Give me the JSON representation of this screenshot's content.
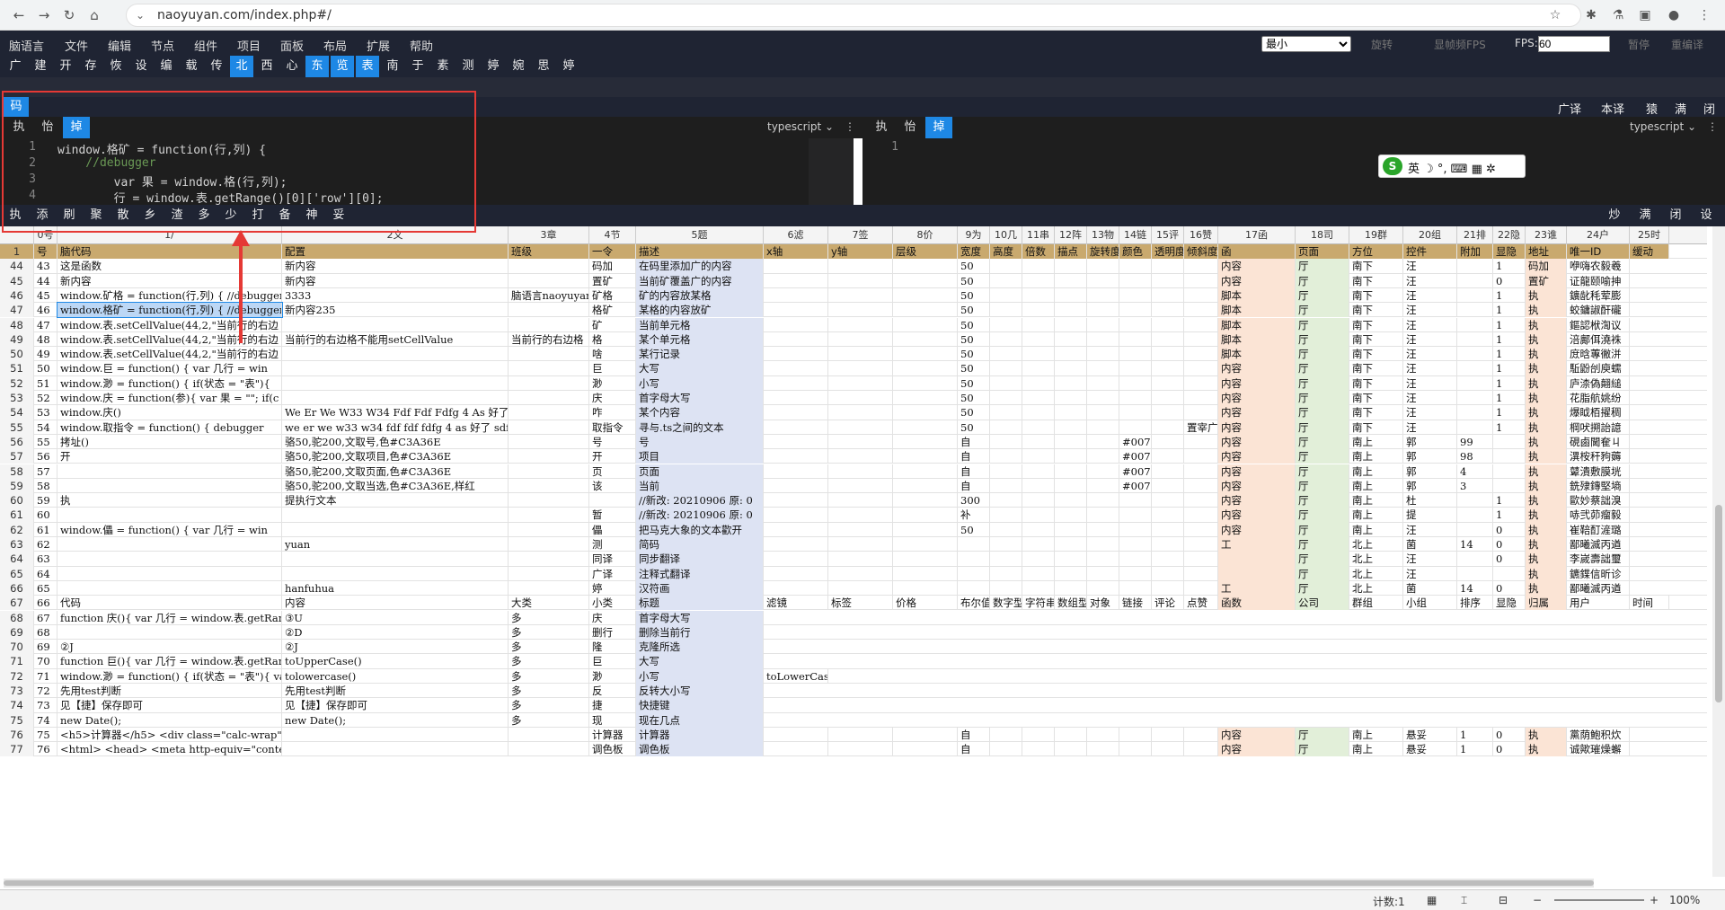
{
  "browser": {
    "url": "naoyuyan.com/index.php#/"
  },
  "menu": {
    "items": [
      "脑语言",
      "文件",
      "编辑",
      "节点",
      "组件",
      "项目",
      "面板",
      "布局",
      "扩展",
      "帮助"
    ],
    "select": "最小",
    "rotate": "旋转",
    "show_fps": "显帧频FPS",
    "fps_label": "FPS:",
    "fps_value": "60",
    "pause": "暂停",
    "recompile": "重编译"
  },
  "toolbar": {
    "items": [
      "广",
      "建",
      "开",
      "存",
      "恢",
      "设",
      "编",
      "载",
      "传",
      "北",
      "西",
      "心",
      "东",
      "览",
      "表",
      "南",
      "于",
      "素",
      "测",
      "婷",
      "婉",
      "思",
      "婷"
    ],
    "active": [
      9,
      12,
      13,
      14
    ]
  },
  "codepanel": {
    "tag": "码",
    "right": [
      "广译",
      "本译",
      "猿",
      "满",
      "闭"
    ]
  },
  "editor1": {
    "buttons": [
      "执",
      "怡",
      "掉"
    ],
    "lang": "typescript",
    "lines": [
      {
        "n": "1",
        "t": "window.格矿 = function(行,列) {"
      },
      {
        "n": "2",
        "t": "    //debugger"
      },
      {
        "n": "3",
        "t": "        var 果 = window.格(行,列);"
      },
      {
        "n": "4",
        "t": "        行 = window.表.getRange()[0]['row'][0];"
      }
    ]
  },
  "editor2": {
    "buttons": [
      "执",
      "怡",
      "掉"
    ],
    "lang": "typescript",
    "lines": [
      {
        "n": "1",
        "t": ""
      }
    ]
  },
  "ime": {
    "text": "英 ☽ °, ⌨ ▦ ✲"
  },
  "cmdbar": {
    "items": [
      "执",
      "添",
      "刷",
      "聚",
      "散",
      "乡",
      "渣",
      "多",
      "少",
      "打",
      "备",
      "神",
      "妥"
    ],
    "right": [
      "炒",
      "满",
      "闭",
      "设"
    ]
  },
  "sheet": {
    "colhead": [
      "",
      "0号",
      "1/",
      "2文",
      "3章",
      "4节",
      "5题",
      "6滤",
      "7签",
      "8价",
      "9为",
      "10几",
      "11串",
      "12阵",
      "13物",
      "14链",
      "15评",
      "16赞",
      "17函",
      "18司",
      "19群",
      "20组",
      "21排",
      "22隐",
      "23谁",
      "24户",
      "25时"
    ],
    "hdr": [
      "1",
      "号",
      "脑代码",
      "配置",
      "班级",
      "一令",
      "描述",
      "x轴",
      "y轴",
      "层级",
      "宽度",
      "高度",
      "倍数",
      "描点",
      "旋转度",
      "颜色",
      "透明度",
      "倾斜度",
      "函",
      "页面",
      "方位",
      "控件",
      "附加",
      "显隐",
      "地址",
      "唯一ID",
      "缓动"
    ],
    "rows": [
      [
        "44",
        "43",
        "这是函数",
        "新内容",
        "",
        "码加",
        "在码里添加广的内容",
        "",
        "",
        "",
        "50",
        "",
        "",
        "",
        "",
        "",
        "",
        "",
        "内容",
        "厅",
        "南下",
        "汪",
        "",
        "1",
        "码加",
        "咿嗨农毅羲"
      ],
      [
        "45",
        "44",
        "新内容",
        "新内容",
        "",
        "置矿",
        "当前矿覆盖广的内容",
        "",
        "",
        "",
        "50",
        "",
        "",
        "",
        "",
        "",
        "",
        "",
        "内容",
        "厅",
        "南下",
        "汪",
        "",
        "0",
        "置矿",
        "证龍颐喻抻"
      ],
      [
        "46",
        "45",
        "window.矿格 = function(行,列) {   //debugger",
        "3333",
        "脑语言naoyuyan",
        "矿格",
        "矿的内容放某格",
        "",
        "",
        "",
        "50",
        "",
        "",
        "",
        "",
        "",
        "",
        "",
        "脚本",
        "厅",
        "南下",
        "汪",
        "",
        "1",
        "执",
        "鑛龀秏荤膨"
      ],
      [
        "47",
        "46",
        "window.格矿 = function(行,列) {   //debugger",
        "新内容235",
        "",
        "格矿",
        "某格的内容放矿",
        "",
        "",
        "",
        "50",
        "",
        "",
        "",
        "",
        "",
        "",
        "",
        "脚本",
        "厅",
        "南下",
        "汪",
        "",
        "1",
        "执",
        "蛟鏞諔酐礲"
      ],
      [
        "48",
        "47",
        "window.表.setCellValue(44,2,\"当前行的右边",
        "",
        "",
        "矿",
        "当前单元格",
        "",
        "",
        "",
        "50",
        "",
        "",
        "",
        "",
        "",
        "",
        "",
        "脚本",
        "厅",
        "南下",
        "汪",
        "",
        "1",
        "执",
        "鏂認栿渹议"
      ],
      [
        "49",
        "48",
        "window.表.setCellValue(44,2,\"当前行的右边",
        "当前行的右边格不能用setCellValue",
        "当前行的右边格",
        "格",
        "某个单元格",
        "",
        "",
        "",
        "50",
        "",
        "",
        "",
        "",
        "",
        "",
        "",
        "脚本",
        "厅",
        "南下",
        "汪",
        "",
        "1",
        "执",
        "涪鄺佴澆袾"
      ],
      [
        "50",
        "49",
        "window.表.setCellValue(44,2,\"当前行的右边",
        "",
        "",
        "啥",
        "某行记录",
        "",
        "",
        "",
        "50",
        "",
        "",
        "",
        "",
        "",
        "",
        "",
        "脚本",
        "厅",
        "南下",
        "汪",
        "",
        "1",
        "执",
        "庻晗蓴徶洴"
      ],
      [
        "51",
        "50",
        "window.巨 = function() {   var 几行 = win",
        "",
        "",
        "巨",
        "大写",
        "",
        "",
        "",
        "50",
        "",
        "",
        "",
        "",
        "",
        "",
        "",
        "内容",
        "厅",
        "南下",
        "汪",
        "",
        "1",
        "执",
        "駈鼢刣庾蠕"
      ],
      [
        "52",
        "51",
        "window.渺 = function() {   if(状态 = \"表\"){",
        "",
        "",
        "渺",
        "小写",
        "",
        "",
        "",
        "50",
        "",
        "",
        "",
        "",
        "",
        "",
        "",
        "内容",
        "厅",
        "南下",
        "汪",
        "",
        "1",
        "执",
        "庐渿偽翸縋"
      ],
      [
        "53",
        "52",
        "window.庆 = function(参){   var 果 = \"\";  if(c",
        "",
        "",
        "庆",
        "首字母大写",
        "",
        "",
        "",
        "50",
        "",
        "",
        "",
        "",
        "",
        "",
        "",
        "内容",
        "厅",
        "南下",
        "汪",
        "",
        "1",
        "执",
        "花脂航姚纷"
      ],
      [
        "54",
        "53",
        "window.庆()",
        "We Er We W33 W34 Fdf Fdf Fdfg 4 As 好了",
        "",
        "咋",
        "某个内容",
        "",
        "",
        "",
        "50",
        "",
        "",
        "",
        "",
        "",
        "",
        "",
        "内容",
        "厅",
        "南下",
        "汪",
        "",
        "1",
        "执",
        "爆眓栢擢稠"
      ],
      [
        "55",
        "54",
        "window.取指令 = function() {   debugger",
        "we er we w33 w34 fdf fdf fdfg 4 as 好了  sdf",
        "",
        "取指令",
        "寻与.ts之间的文本",
        "",
        "",
        "",
        "50",
        "",
        "",
        "",
        "",
        "",
        "",
        "置宰广",
        "内容",
        "厅",
        "南下",
        "汪",
        "",
        "1",
        "执",
        "棡吠搠詒譩"
      ],
      [
        "56",
        "55",
        "拷址()",
        "骆50,驼200,文取号,色#C3A36E",
        "",
        "号",
        "号",
        "",
        "",
        "",
        "自",
        "",
        "",
        "",
        "",
        "#007ac",
        "",
        "",
        "内容",
        "厅",
        "南上",
        "郭",
        "99",
        "",
        "执",
        "硯鹵閫奞ㄐ"
      ],
      [
        "57",
        "56",
        "开",
        "骆50,驼200,文取项目,色#C3A36E",
        "",
        "开",
        "项目",
        "",
        "",
        "",
        "自",
        "",
        "",
        "",
        "",
        "#007ac",
        "",
        "",
        "内容",
        "厅",
        "南上",
        "郭",
        "98",
        "",
        "执",
        "潩桉秆豞薅"
      ],
      [
        "58",
        "57",
        "",
        "骆50,驼200,文取页面,色#C3A36E",
        "",
        "页",
        "页面",
        "",
        "",
        "",
        "自",
        "",
        "",
        "",
        "",
        "#007ac",
        "",
        "",
        "内容",
        "厅",
        "南上",
        "郭",
        "4",
        "",
        "执",
        "鼙潰敷膜垙"
      ],
      [
        "59",
        "58",
        "",
        "骆50,驼200,文取当选,色#C3A36E,样红",
        "",
        "该",
        "当前",
        "",
        "",
        "",
        "自",
        "",
        "",
        "",
        "",
        "#007ac",
        "",
        "",
        "内容",
        "厅",
        "南上",
        "郭",
        "3",
        "",
        "执",
        "銑殔鏄堅墒"
      ],
      [
        "60",
        "59",
        "执",
        "提执行文本",
        "",
        "",
        "//新改: 20210906 原: 0",
        "",
        "",
        "",
        "300",
        "",
        "",
        "",
        "",
        "",
        "",
        "",
        "内容",
        "厅",
        "南上",
        "杜",
        "",
        "1",
        "执",
        "歐妙蔡詘溴"
      ],
      [
        "61",
        "60",
        "",
        "",
        "",
        "暂",
        "//新改: 20210906 原: 0",
        "",
        "",
        "",
        "补",
        "",
        "",
        "",
        "",
        "",
        "",
        "",
        "内容",
        "厅",
        "南上",
        "提",
        "",
        "1",
        "执",
        "哧弐茆瘤毅"
      ],
      [
        "62",
        "61",
        "window.儡 = function() {   var 几行 = win",
        "",
        "",
        "儡",
        "把马克大象的文本歡开",
        "",
        "",
        "",
        "50",
        "",
        "",
        "",
        "",
        "",
        "",
        "",
        "内容",
        "厅",
        "南上",
        "汪",
        "",
        "0",
        "执",
        "崔鞛酊滻璐"
      ],
      [
        "63",
        "62",
        "",
        "yuan",
        "",
        "测",
        "简码",
        "",
        "",
        "",
        "",
        "",
        "",
        "",
        "",
        "",
        "",
        "",
        "工",
        "厅",
        "北上",
        "菌",
        "14",
        "0",
        "执",
        "鄙曦滅丙遒"
      ],
      [
        "64",
        "63",
        "",
        "",
        "",
        "同译",
        "同步翻译",
        "",
        "",
        "",
        "",
        "",
        "",
        "",
        "",
        "",
        "",
        "",
        "",
        "厅",
        "北上",
        "汪",
        "",
        "0",
        "执",
        "李嵗壽詘璽"
      ],
      [
        "65",
        "64",
        "",
        "",
        "",
        "广译",
        "注释式翻译",
        "",
        "",
        "",
        "",
        "",
        "",
        "",
        "",
        "",
        "",
        "",
        "",
        "厅",
        "北上",
        "汪",
        "",
        "",
        "执",
        "鑣鍱信昕诊"
      ],
      [
        "66",
        "65",
        "",
        "hanfuhua",
        "",
        "婷",
        "汉符画",
        "",
        "",
        "",
        "",
        "",
        "",
        "",
        "",
        "",
        "",
        "",
        "工",
        "厅",
        "北上",
        "菌",
        "14",
        "0",
        "执",
        "鄙曦滅丙遒"
      ]
    ],
    "hdr2": [
      "67",
      "66",
      "代码",
      "内容",
      "大类",
      "小类",
      "标题",
      "滤镜",
      "标签",
      "价格",
      "布尔值",
      "数字型",
      "字符串",
      "数组型",
      "对象",
      "链接",
      "评论",
      "点赞",
      "函数",
      "公司",
      "群组",
      "小组",
      "排序",
      "显隐",
      "归属",
      "用户",
      "时间"
    ],
    "rows2": [
      [
        "68",
        "67",
        "function 庆(){ var 几行 = window.表.getRang",
        "③U",
        "多",
        "庆",
        "首字母大写"
      ],
      [
        "69",
        "68",
        "",
        "②D",
        "多",
        "删行",
        "删除当前行"
      ],
      [
        "70",
        "69",
        "②J",
        "②J",
        "多",
        "隆",
        "克隆所选"
      ],
      [
        "71",
        "70",
        "function 巨(){ var 几行 = window.表.getRang",
        "toUpperCase()",
        "多",
        "巨",
        "大写"
      ],
      [
        "72",
        "71",
        "window.渺 = function() { if(状态 = \"表\"){ var",
        "tolowercase()",
        "多",
        "渺",
        "小写",
        "toLowerCase"
      ],
      [
        "73",
        "72",
        "先用test判断",
        "先用test判断",
        "多",
        "反",
        "反转大小写"
      ],
      [
        "74",
        "73",
        "见【捷】保存即可",
        "见【捷】保存即可",
        "多",
        "捷",
        "快捷键"
      ],
      [
        "75",
        "74",
        "new Date();",
        "new Date();",
        "多",
        "现",
        "现在几点"
      ],
      [
        "76",
        "75",
        "<h5>计算器</h5>    <div class=\"calc-wrap\">",
        "",
        "",
        "计算器",
        "计算器",
        "",
        "",
        "",
        "自",
        "",
        "",
        "",
        "",
        "",
        "",
        "",
        "内容",
        "厅",
        "南上",
        "悬妥",
        "1",
        "0",
        "执",
        "黨荫鮑积炊"
      ],
      [
        "77",
        "76",
        "<html> <head> <meta http-equiv=\"content-Ty",
        "",
        "",
        "调色板",
        "调色板",
        "",
        "",
        "",
        "自",
        "",
        "",
        "",
        "",
        "",
        "",
        "",
        "内容",
        "厅",
        "南上",
        "悬妥",
        "1",
        "0",
        "执",
        "诚歟璀燥蠏"
      ]
    ]
  },
  "status": {
    "count": "计数:1",
    "zoom": "100%"
  }
}
